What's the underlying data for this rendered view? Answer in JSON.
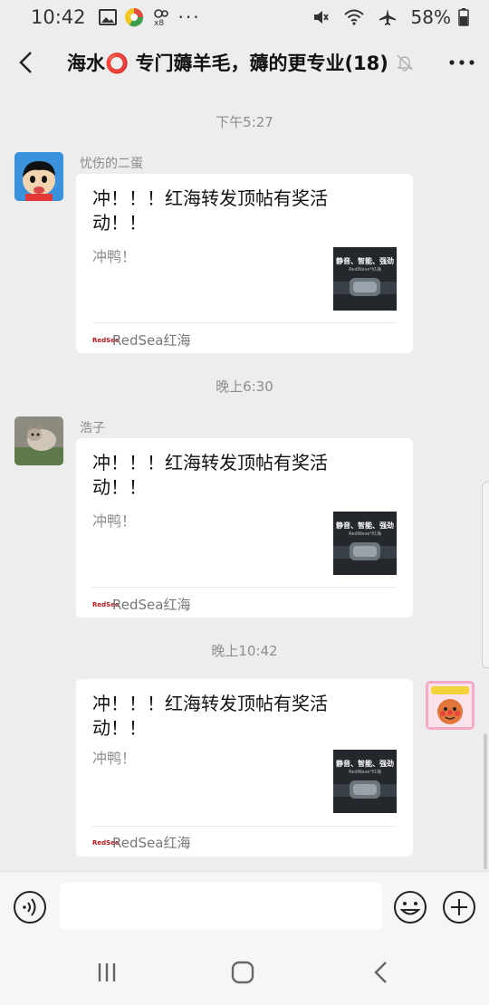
{
  "status": {
    "time": "10:42",
    "battery": "58%"
  },
  "header": {
    "title": "海水⭕ 专门薅羊毛，薅的更专业(18)"
  },
  "messages": [
    {
      "timestamp": "下午5:27",
      "sender": "忧伤的二蛋",
      "title": "冲！！！红海转发顶帖有奖活动！！",
      "desc": "冲鸭！",
      "source": "RedSea红海",
      "thumb_caption": "静音、智能、强劲",
      "thumb_sub": "RedWave*红海"
    },
    {
      "timestamp": "晚上6:30",
      "sender": "浩子",
      "title": "冲！！！红海转发顶帖有奖活动！！",
      "desc": "冲鸭！",
      "source": "RedSea红海",
      "thumb_caption": "静音、智能、强劲",
      "thumb_sub": "RedWave*红海"
    },
    {
      "timestamp": "晚上10:42",
      "sender": "",
      "title": "冲！！！红海转发顶帖有奖活动！！",
      "desc": "冲鸭！",
      "source": "RedSea红海",
      "thumb_caption": "静音、智能、强劲",
      "thumb_sub": "RedWave*红海"
    }
  ],
  "source_logo_text": "RedSea",
  "input": {
    "placeholder": ""
  },
  "colors": {
    "bg": "#ededed",
    "card": "#ffffff",
    "brand_red": "#c0161a"
  }
}
